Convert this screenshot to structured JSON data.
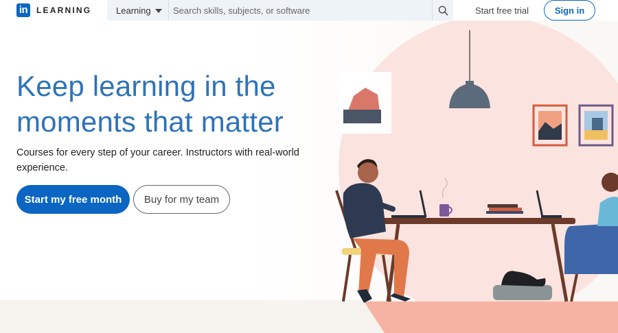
{
  "header": {
    "logo_mark": "in",
    "logo_text": "LEARNING",
    "search": {
      "category": "Learning",
      "placeholder": "Search skills, subjects, or software"
    },
    "start_free_trial": "Start free trial",
    "sign_in": "Sign in"
  },
  "hero": {
    "headline": "Keep learning in the moments that matter",
    "subtext": "Courses for every step of your career. Instructors with real-world experience.",
    "primary_button": "Start my free month",
    "secondary_button": "Buy for my team"
  },
  "colors": {
    "brand_blue": "#0a66c2",
    "headline_blue": "#2e73b8",
    "illustration_pink": "#fbe3df"
  },
  "icons": [
    "linkedin-logo-icon",
    "chevron-down-icon",
    "search-icon"
  ]
}
